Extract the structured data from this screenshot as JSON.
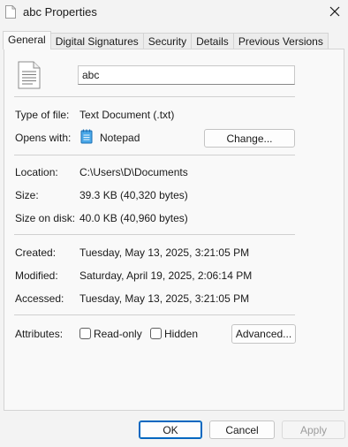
{
  "window": {
    "title": "abc Properties",
    "title_icon": "document-icon",
    "close_icon": "close-icon"
  },
  "tabs": [
    {
      "label": "General",
      "active": true
    },
    {
      "label": "Digital Signatures",
      "active": false
    },
    {
      "label": "Security",
      "active": false
    },
    {
      "label": "Details",
      "active": false
    },
    {
      "label": "Previous Versions",
      "active": false
    }
  ],
  "general": {
    "file_icon": "text-file-icon",
    "file_name": "abc",
    "type_label": "Type of file:",
    "type_value": "Text Document (.txt)",
    "opens_label": "Opens with:",
    "opens_app": "Notepad",
    "opens_app_icon": "notepad-icon",
    "change_button": "Change...",
    "location_label": "Location:",
    "location_value": "C:\\Users\\D\\Documents",
    "size_label": "Size:",
    "size_value": "39.3 KB (40,320 bytes)",
    "size_disk_label": "Size on disk:",
    "size_disk_value": "40.0 KB (40,960 bytes)",
    "created_label": "Created:",
    "created_value": "Tuesday, May 13, 2025, 3:21:05 PM",
    "modified_label": "Modified:",
    "modified_value": "Saturday, April 19, 2025, 2:06:14 PM",
    "accessed_label": "Accessed:",
    "accessed_value": "Tuesday, May 13, 2025, 3:21:05 PM",
    "attributes_label": "Attributes:",
    "readonly_label": "Read-only",
    "readonly_checked": false,
    "hidden_label": "Hidden",
    "hidden_checked": false,
    "advanced_button": "Advanced..."
  },
  "footer": {
    "ok": "OK",
    "cancel": "Cancel",
    "apply": "Apply",
    "apply_enabled": false
  },
  "colors": {
    "accent": "#0067c0",
    "background": "#f3f3f3",
    "panel": "#f9f9f9"
  }
}
